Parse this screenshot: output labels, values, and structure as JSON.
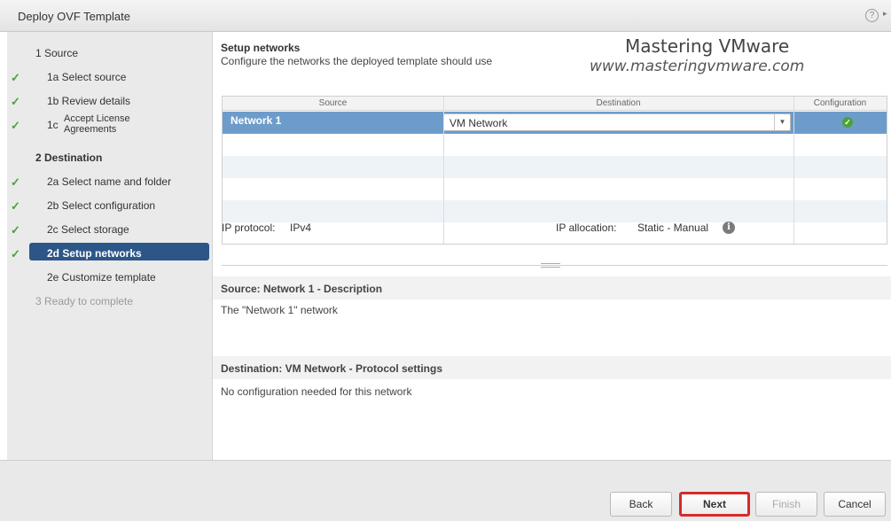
{
  "window": {
    "title": "Deploy OVF Template",
    "help_label": "?",
    "collapse_label": "▸"
  },
  "watermark": {
    "line1": "Mastering VMware",
    "line2": "www.masteringvmware.com"
  },
  "steps": {
    "s1": "1  Source",
    "s1a": "1a  Select source",
    "s1b": "1b  Review details",
    "s1c_num": "1c",
    "s1c_line1": "Accept License",
    "s1c_line2": "Agreements",
    "s2": "2  Destination",
    "s2a": "2a  Select name and folder",
    "s2b": "2b  Select configuration",
    "s2c": "2c  Select storage",
    "s2d": "2d  Setup networks",
    "s2e": "2e  Customize template",
    "s3": "3  Ready to complete",
    "check": "✓"
  },
  "page": {
    "heading": "Setup networks",
    "subheading": "Configure the networks the deployed template should use"
  },
  "grid": {
    "columns": [
      "Source",
      "Destination",
      "Configuration"
    ],
    "rows": [
      {
        "source": "Network 1",
        "destination": "VM Network",
        "status_icon": "check-circle-icon"
      }
    ],
    "dropdown_glyph": "▼",
    "ok_glyph": "✓"
  },
  "ip": {
    "protocol_label": "IP protocol:",
    "protocol_value": "IPv4",
    "allocation_label": "IP allocation:",
    "allocation_value": "Static - Manual",
    "info_glyph": "i"
  },
  "source_desc": {
    "title": "Source: Network 1 - Description",
    "text": "The \"Network 1\" network"
  },
  "dest_desc": {
    "title": "Destination: VM Network - Protocol settings",
    "text": "No configuration needed for this network"
  },
  "buttons": {
    "back": "Back",
    "next": "Next",
    "finish": "Finish",
    "cancel": "Cancel"
  },
  "colors": {
    "active_step": "#2d5688",
    "selected_row": "#6d9ccb",
    "check": "#4aa23b",
    "highlight_border": "#d62a2a"
  }
}
